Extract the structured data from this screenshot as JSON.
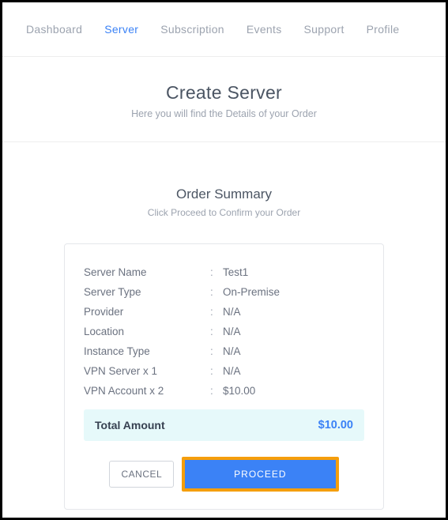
{
  "nav": {
    "items": [
      {
        "label": "Dashboard",
        "active": false
      },
      {
        "label": "Server",
        "active": true
      },
      {
        "label": "Subscription",
        "active": false
      },
      {
        "label": "Events",
        "active": false
      },
      {
        "label": "Support",
        "active": false
      },
      {
        "label": "Profile",
        "active": false
      }
    ]
  },
  "header": {
    "title": "Create Server",
    "subtitle": "Here you will find the Details of your Order"
  },
  "summary": {
    "title": "Order Summary",
    "subtitle": "Click Proceed to Confirm your Order",
    "rows": [
      {
        "label": "Server Name",
        "value": "Test1"
      },
      {
        "label": "Server Type",
        "value": "On-Premise"
      },
      {
        "label": "Provider",
        "value": "N/A"
      },
      {
        "label": "Location",
        "value": "N/A"
      },
      {
        "label": "Instance Type",
        "value": "N/A"
      },
      {
        "label": "VPN Server x 1",
        "value": "N/A"
      },
      {
        "label": "VPN Account x 2",
        "value": "$10.00"
      }
    ],
    "total_label": "Total Amount",
    "total_value": "$10.00"
  },
  "actions": {
    "cancel": "CANCEL",
    "proceed": "PROCEED"
  }
}
